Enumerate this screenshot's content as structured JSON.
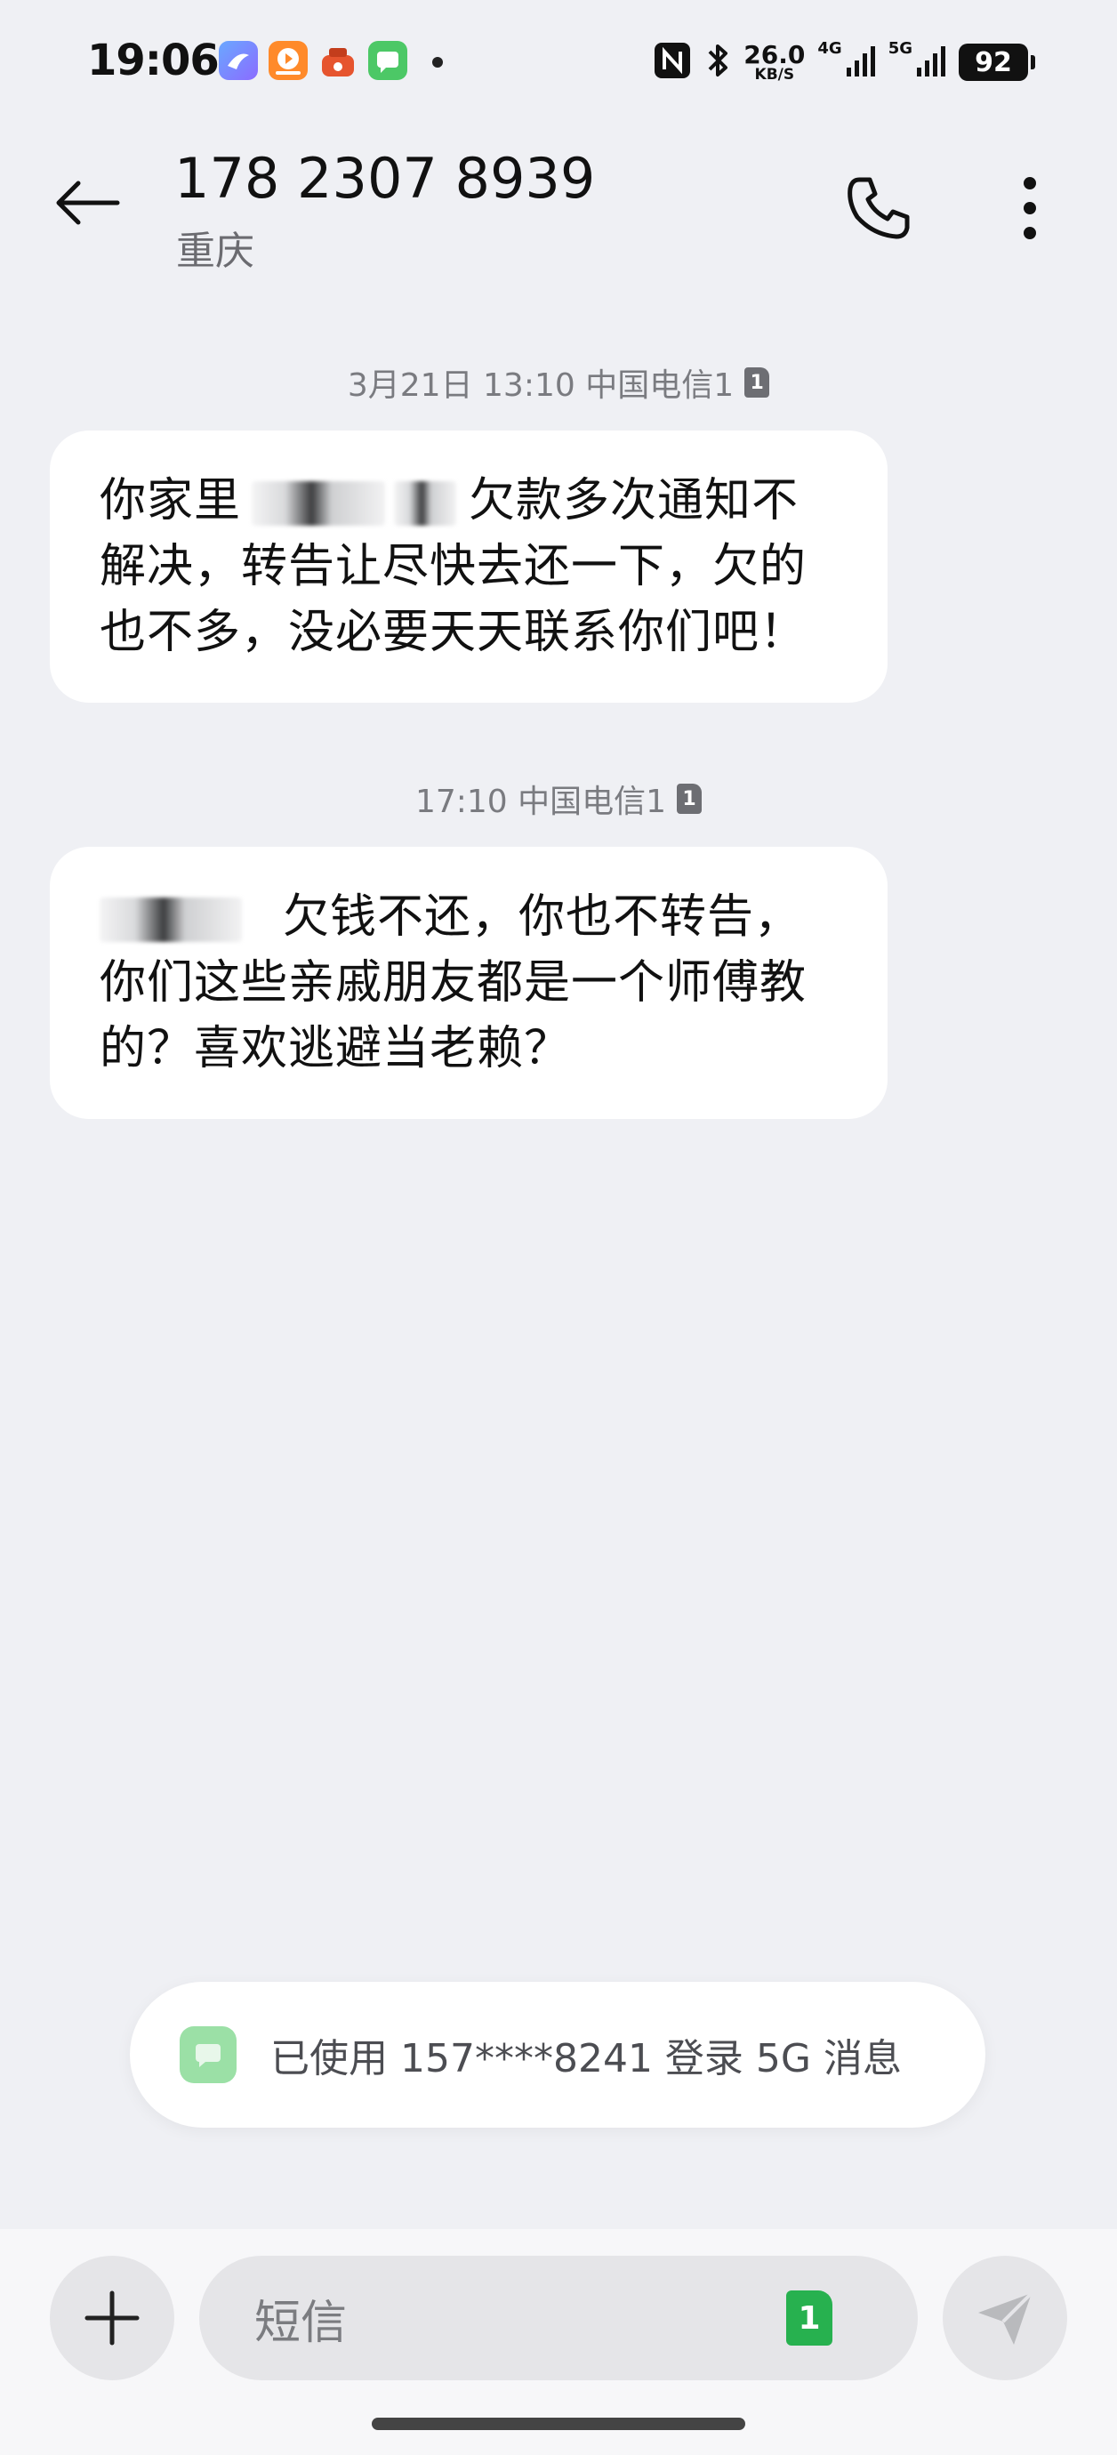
{
  "status_bar": {
    "time": "19:06",
    "notification_icons": [
      "compass-app-icon",
      "video-app-icon",
      "shop-app-icon",
      "messages-app-icon"
    ],
    "speed_value": "26.0",
    "speed_unit": "KB/S",
    "network_4g": "4G",
    "network_5g": "5G",
    "battery": "92"
  },
  "header": {
    "phone_number": "178 2307 8939",
    "location": "重庆"
  },
  "messages": [
    {
      "timestamp": "3月21日 13:10 中国电信1",
      "sim": "1",
      "text_before": "你家里",
      "text_after": "欠款多次通知不解决，转告让尽快去还一下，欠的也不多，没必要天天联系你们吧！"
    },
    {
      "timestamp": "17:10 中国电信1",
      "sim": "1",
      "text_before": "",
      "text_after": "欠钱不还，你也不转告，你们这些亲戚朋友都是一个师傅教的？喜欢逃避当老赖？"
    }
  ],
  "toast": {
    "text": "已使用 157****8241 登录 5G 消息"
  },
  "compose": {
    "placeholder": "短信",
    "sim": "1"
  },
  "colors": {
    "background": "#eff0f4",
    "bubble": "#ffffff",
    "sim_green": "#27b14f",
    "toast_icon": "#9be0a6"
  }
}
